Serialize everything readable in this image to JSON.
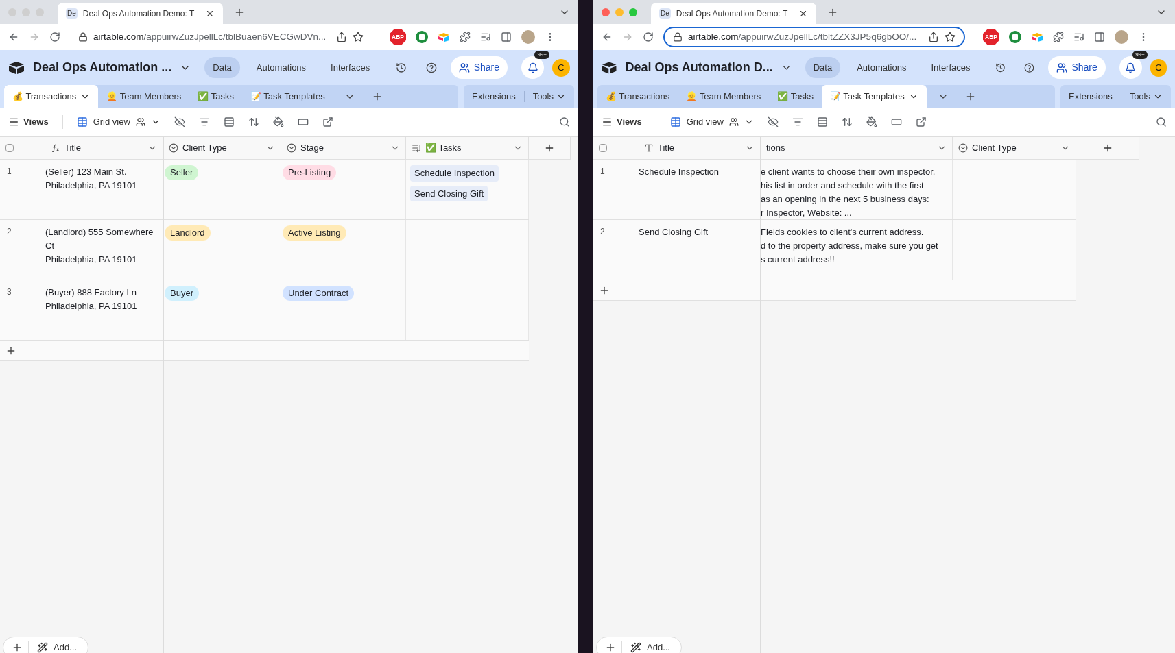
{
  "windows": [
    {
      "focused": false,
      "select_all_checked": false,
      "browser_tab": {
        "favicon": "De",
        "title": "Deal Ops Automation Demo: T"
      },
      "url_host": "airtable.com",
      "url_path": "/appuirwZuzJpellLc/tblBuaen6VECGwDVn...",
      "ext_badge": "ABP",
      "base_name": "Deal Ops Automation ...",
      "nav": [
        {
          "label": "Data",
          "selected": true
        },
        {
          "label": "Automations",
          "selected": false
        },
        {
          "label": "Interfaces",
          "selected": false
        }
      ],
      "share": "Share",
      "badge": "99+",
      "avatar": "C",
      "tables": [
        {
          "label": "💰 Transactions",
          "selected": true
        },
        {
          "label": "👱 Team Members",
          "selected": false
        },
        {
          "label": "✅ Tasks",
          "selected": false
        },
        {
          "label": "📝 Task Templates",
          "selected": false
        }
      ],
      "extensions": "Extensions",
      "tools": "Tools",
      "views": "Views",
      "grid_view": "Grid view",
      "columns": [
        {
          "name": "Title",
          "kind": "formula"
        },
        {
          "name": "Client Type",
          "kind": "select"
        },
        {
          "name": "Stage",
          "kind": "select"
        },
        {
          "name": "✅ Tasks",
          "kind": "link"
        }
      ],
      "rows": [
        {
          "number": "1",
          "cells": [
            {
              "text": "(Seller) 123 Main St.\nPhiladelphia, PA 19101"
            },
            {
              "tags": [
                {
                  "label": "Seller",
                  "color": "#cff5d1"
                }
              ]
            },
            {
              "tags": [
                {
                  "label": "Pre-Listing",
                  "color": "#ffdce5"
                }
              ]
            },
            {
              "tags": [
                {
                  "label": "Schedule Inspection",
                  "color": "#e6ecf8"
                },
                {
                  "label": "Send Closing Gift",
                  "color": "#e6ecf8"
                }
              ]
            }
          ]
        },
        {
          "number": "2",
          "cells": [
            {
              "text": "(Landlord) 555 Somewhere Ct\nPhiladelphia, PA 19101"
            },
            {
              "tags": [
                {
                  "label": "Landlord",
                  "color": "#ffeab6"
                }
              ]
            },
            {
              "tags": [
                {
                  "label": "Active Listing",
                  "color": "#ffeab6"
                }
              ]
            }
          ]
        },
        {
          "number": "3",
          "cells": [
            {
              "text": "(Buyer) 888 Factory Ln\nPhiladelphia, PA 19101"
            },
            {
              "tags": [
                {
                  "label": "Buyer",
                  "color": "#d0f0fd"
                }
              ]
            },
            {
              "tags": [
                {
                  "label": "Under Contract",
                  "color": "#d1e2ff"
                }
              ]
            }
          ]
        }
      ],
      "add_label": "Add..."
    },
    {
      "focused": true,
      "select_all_checked": false,
      "browser_tab": {
        "favicon": "De",
        "title": "Deal Ops Automation Demo: T"
      },
      "url_host": "airtable.com",
      "url_path": "/appuirwZuzJpellLc/tbltZZX3JP5q6gbOO/...",
      "ext_badge": "ABP",
      "base_name": "Deal Ops Automation D...",
      "nav": [
        {
          "label": "Data",
          "selected": true
        },
        {
          "label": "Automations",
          "selected": false
        },
        {
          "label": "Interfaces",
          "selected": false
        }
      ],
      "share": "Share",
      "badge": "99+",
      "avatar": "C",
      "tables": [
        {
          "label": "💰 Transactions",
          "selected": false
        },
        {
          "label": "👱 Team Members",
          "selected": false
        },
        {
          "label": "✅ Tasks",
          "selected": false
        },
        {
          "label": "📝 Task Templates",
          "selected": true
        }
      ],
      "extensions": "Extensions",
      "tools": "Tools",
      "views": "Views",
      "grid_view": "Grid view",
      "columns": [
        {
          "name": "Title",
          "kind": "text"
        },
        {
          "name": "tions",
          "kind": "long_text"
        },
        {
          "name": "Client Type",
          "kind": "select"
        }
      ],
      "rows": [
        {
          "number": "1",
          "cells": [
            {
              "text": "Schedule Inspection"
            },
            {
              "text": "e client wants to choose their own inspector,\nhis list in order and schedule with the first\nas an opening in the next 5 business days:\nr Inspector, Website: ..."
            }
          ]
        },
        {
          "number": "2",
          "cells": [
            {
              "text": "Send Closing Gift"
            },
            {
              "text": "Fields cookies to client's current address.\nd to the property address, make sure you get\ns current address!!"
            }
          ]
        }
      ],
      "add_label": "Add..."
    }
  ]
}
